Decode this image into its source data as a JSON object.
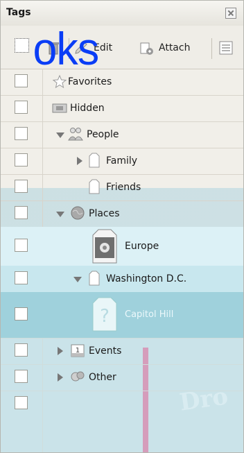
{
  "panel": {
    "title": "Tags"
  },
  "toolbar": {
    "edit": "Edit",
    "attach": "Attach"
  },
  "overlay": {
    "text": "oks"
  },
  "watermark": {
    "text": "Dro"
  },
  "tags": [
    {
      "label": "Favorites",
      "icon": "star-icon"
    },
    {
      "label": "Hidden",
      "icon": "hidden-icon"
    },
    {
      "label": "People",
      "icon": "people-icon"
    },
    {
      "label": "Family",
      "icon": "tag-icon"
    },
    {
      "label": "Friends",
      "icon": "tag-icon"
    },
    {
      "label": "Places",
      "icon": "globe-icon"
    },
    {
      "label": "Europe",
      "icon": "photo-tag-icon"
    },
    {
      "label": "Washington D.C.",
      "icon": "tag-icon"
    },
    {
      "label": "Capitol Hill",
      "icon": "question-tag-icon"
    },
    {
      "label": "Events",
      "icon": "calendar-icon"
    },
    {
      "label": "Other",
      "icon": "other-icon"
    }
  ],
  "colors": {
    "overlay_text": "#0a3df6",
    "selected_row": "#9fd1dc",
    "panel_bg": "#f1efe9"
  }
}
